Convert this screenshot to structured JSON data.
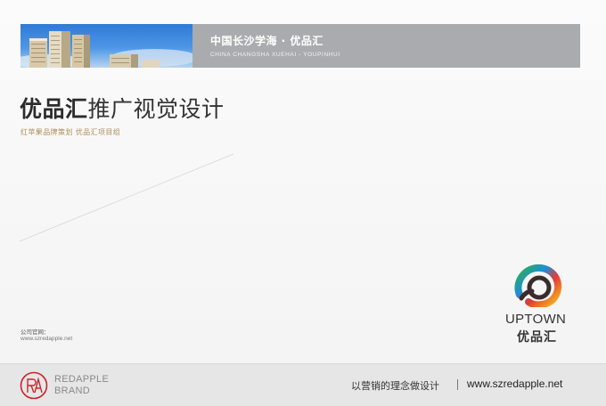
{
  "header": {
    "title_cn": "中国长沙学海 · 优品汇",
    "title_en": "CHINA  CHANGSHA  XUEHAI - YOUPINHUI"
  },
  "main": {
    "title_bold": "优品汇",
    "title_rest": "推广视觉设计",
    "subtitle": "红苹果品牌策划   优品汇项目组"
  },
  "website": {
    "label": "公司官网：",
    "url": "www.szredapple.net"
  },
  "logo": {
    "name_en": "UPTOWN",
    "name_cn": "优品汇"
  },
  "footer": {
    "brand_line1": "REDAPPLE",
    "brand_line2": "BRAND",
    "slogan": "以营销的理念做设计",
    "url": "www.szredapple.net"
  },
  "colors": {
    "header_band": "#a9abae",
    "subtitle_gold": "#b08d5a",
    "brand_red": "#c8242b",
    "footer_bg": "#e6e6e6"
  }
}
